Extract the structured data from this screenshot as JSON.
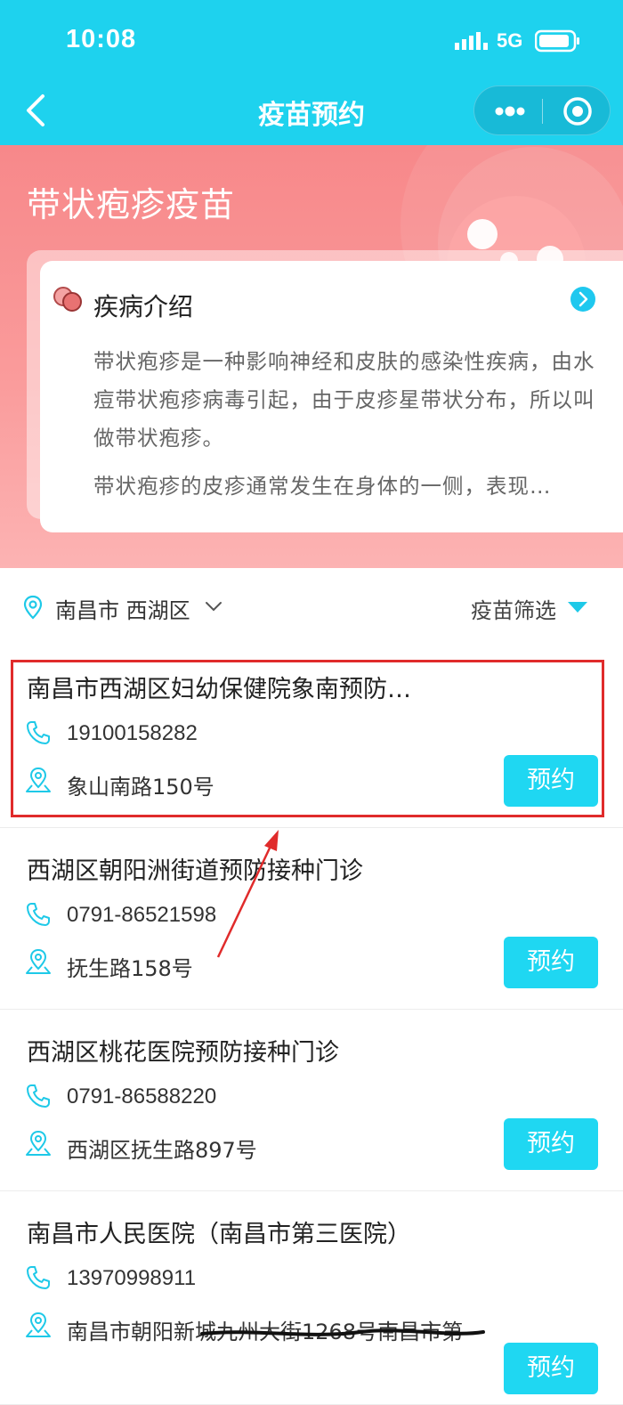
{
  "status_bar": {
    "time": "10:08",
    "network": "5G"
  },
  "nav": {
    "title": "疫苗预约"
  },
  "banner": {
    "title": "带状疱疹疫苗",
    "intro": {
      "title": "疾病介绍",
      "paragraph1": "带状疱疹是一种影响神经和皮肤的感染性疾病，由水痘带状疱疹病毒引起，由于皮疹星带状分布，所以叫做带状疱疹。",
      "paragraph2": "带状疱疹的皮疹通常发生在身体的一侧，表现…"
    }
  },
  "filter": {
    "location": "南昌市 西湖区",
    "vaccine_filter": "疫苗筛选"
  },
  "clinics": [
    {
      "name": "南昌市西湖区妇幼保健院象南预防…",
      "phone": "19100158282",
      "address": "象山南路150号",
      "button": "预约"
    },
    {
      "name": "西湖区朝阳洲街道预防接种门诊",
      "phone": "0791-86521598",
      "address": "抚生路158号",
      "button": "预约"
    },
    {
      "name": "西湖区桃花医院预防接种门诊",
      "phone": "0791-86588220",
      "address": "西湖区抚生路897号",
      "button": "预约"
    },
    {
      "name": "南昌市人民医院（南昌市第三医院）",
      "phone": "13970998911",
      "address": "南昌市朝阳新城九州大街1268号南昌市第",
      "button": "预约"
    }
  ],
  "colors": {
    "primary": "#1ed2ee",
    "banner": "#f7888a",
    "annotation": "#e02b2b"
  }
}
